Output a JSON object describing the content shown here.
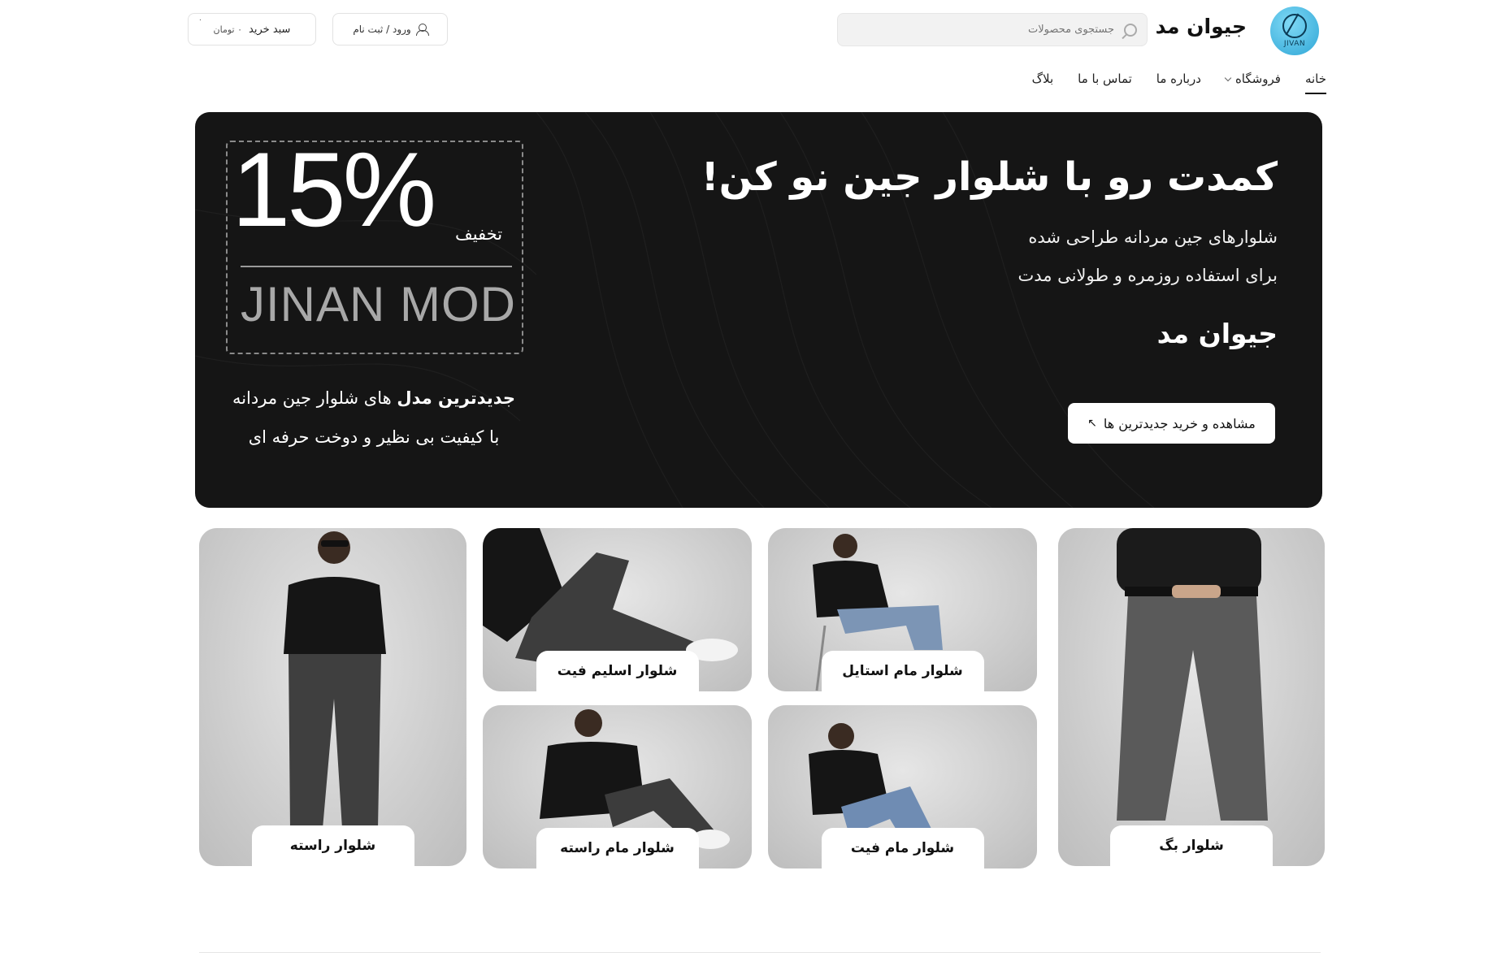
{
  "header": {
    "logo_text": "JIVAN",
    "brand": "جیوان مد",
    "search_placeholder": "جستجوی محصولات",
    "login_label": "ورود / ثبت نام",
    "cart_label": "سبد خرید",
    "cart_price": "۰ تومان",
    "cart_count": "۰"
  },
  "nav": {
    "items": [
      "خانه",
      "فروشگاه",
      "درباره ما",
      "تماس با ما",
      "بلاگ"
    ]
  },
  "hero": {
    "title": "کمدت رو با شلوار جین نو کن!",
    "subtitle_line1": "شلوارهای جین مردانه طراحی شده",
    "subtitle_line2": "برای استفاده روزمره و طولانی مدت",
    "brand": "جیوان مد",
    "cta_label": "مشاهده و خرید جدیدترین ها",
    "discount_percent": "15%",
    "discount_word": "تخفیف",
    "brand_latin": "JINAN MOD",
    "promo_bold": "جدیدترین مدل",
    "promo_rest": " های شلوار جین مردانه",
    "promo_line2": "با کیفیت بی نظیر و دوخت حرفه ای"
  },
  "categories": [
    {
      "label": "شلوار بگ"
    },
    {
      "label": "شلوار مام استایل"
    },
    {
      "label": "شلوار اسلیم فیت"
    },
    {
      "label": "شلوار راسته"
    },
    {
      "label": "شلوار مام فیت"
    },
    {
      "label": "شلوار مام راسته"
    }
  ],
  "colors": {
    "hero_bg": "#151515",
    "accent_logo": "#2fa6d6"
  }
}
